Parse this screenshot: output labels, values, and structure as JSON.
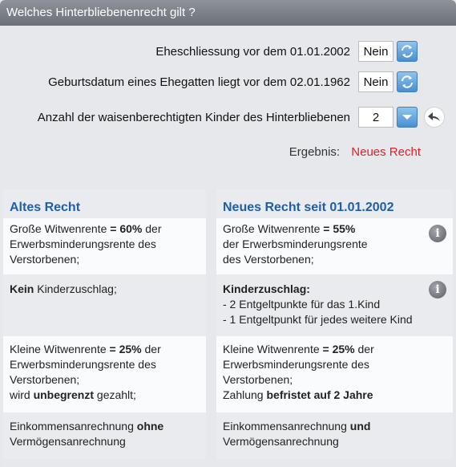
{
  "header": {
    "title": "Welches Hinterbliebenenrecht gilt ?"
  },
  "questions": [
    {
      "label": "Eheschliessung vor dem 01.01.2002",
      "value": "Nein",
      "button_icon": "refresh-icon"
    },
    {
      "label": "Geburtsdatum eines Ehegatten liegt vor dem 02.01.1962",
      "value": "Nein",
      "button_icon": "refresh-icon"
    },
    {
      "label": "Anzahl der waisenberechtigten Kinder des Hinterbliebenen",
      "value": "2",
      "button_icon": "chevron-down-icon"
    }
  ],
  "back_button_icon": "back-arrow-icon",
  "result": {
    "label": "Ergebnis:",
    "value": "Neues Recht",
    "value_color": "#e41e26"
  },
  "accent_color": "#1f5ea8",
  "columns": {
    "left": {
      "title": "Altes Recht",
      "rows": [
        {
          "parts": [
            "Große Witwenrente ",
            "= 60%",
            " der Erwerbsminderungsrente des Verstorbenen;"
          ]
        },
        {
          "parts": [
            "Kein",
            " Kinderzuschlag;"
          ]
        },
        {
          "parts": [
            "Kleine Witwenrente ",
            "= 25%",
            " der Erwerbsminderungsrente des Verstorbenen;",
            "wird ",
            "unbegrenzt",
            " gezahlt;"
          ]
        },
        {
          "parts": [
            "Einkommensanrechnung ",
            "ohne",
            " Vermögensanrechnung"
          ]
        }
      ]
    },
    "right": {
      "title": "Neues Recht seit 01.01.2002",
      "rows": [
        {
          "parts": [
            "Große Witwenrente ",
            "= 55%",
            "der Erwerbsminderungsrente",
            "des Verstorbenen;"
          ]
        },
        {
          "parts": [
            "Kinderzuschlag:",
            "- 2 Entgeltpunkte für das 1.Kind",
            "- 1 Entgeltpunkt für jedes weitere Kind"
          ]
        },
        {
          "parts": [
            "Kleine Witwenrente ",
            "= 25%",
            " der Erwerbsminderungsrente des Verstorbenen;",
            "Zahlung ",
            "befristet auf 2 Jahre"
          ]
        },
        {
          "parts": [
            "Einkommensanrechnung ",
            "und",
            " Vermögensanrechnung"
          ]
        }
      ]
    }
  }
}
